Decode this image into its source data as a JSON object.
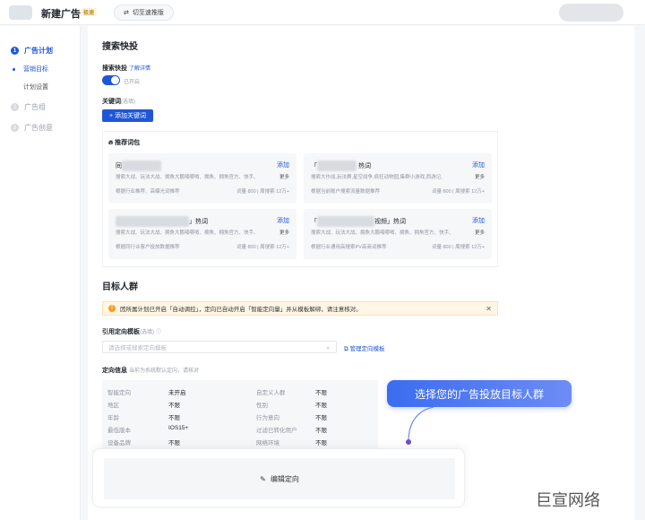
{
  "header": {
    "title": "新建广告",
    "speed_tag": "极速",
    "switch_label": "切至速推版"
  },
  "sidebar": {
    "items": [
      {
        "num": "1",
        "label": "广告计划",
        "active": true
      },
      {
        "num": "2",
        "label": "广告组",
        "active": false
      },
      {
        "num": "3",
        "label": "广告创意",
        "active": false
      }
    ],
    "sub_items": [
      {
        "label": "营销目标",
        "active": true
      },
      {
        "label": "计划设置",
        "active": false
      }
    ]
  },
  "search_express": {
    "heading": "搜索快投",
    "label": "搜索快投",
    "learn_more": "了解详情",
    "toggle_text": "已开启",
    "keyword_label": "关键词",
    "keyword_hint": "(选填)",
    "add_keyword": "+ 添加关键词",
    "rec_title": "推荐词包",
    "cards": [
      {
        "prefix": "同",
        "suffix": "",
        "add": "添加",
        "desc": "搜索大战、玩法大战、拥魚大鹏喃哪呶、拥魚、拥魚官方、快手、",
        "more": "更多",
        "foot": "根据行业推荐、高曝光词推荐",
        "stats": "词量 800 | 周搜索 12万+"
      },
      {
        "prefix": "「",
        "suffix": "热词",
        "add": "添加",
        "desc": "搜索大作战,玩法赛,星空战争,疯狂动物园,集群小游戏,西游记,",
        "more": "更多",
        "foot": "根据当前账户搜索流量数据推荐",
        "stats": "词量 800 | 周搜索 12万+"
      },
      {
        "prefix": "",
        "suffix": "」热词",
        "add": "添加",
        "desc": "搜索大战、玩法大战、拥魚大鹏喃哪呶、拥魚、拥魚官方、快手、",
        "more": "更多",
        "foot": "根据同行业客户投放数据推荐",
        "stats": "词量 800 | 周搜索 12万+"
      },
      {
        "prefix": "「",
        "suffix": "视频」热词",
        "add": "添加",
        "desc": "搜索大战、玩法大战、拥魚大鹏喃哪呶、拥魚、拥魚官方、快手、",
        "more": "更多",
        "foot": "根据行业通用高搜索PV高商词推荐",
        "stats": "词量 800 | 周搜索 12万+"
      }
    ]
  },
  "audience": {
    "heading": "目标人群",
    "alert": "因所属计划已开启「自动调控」，定向已自动开启「智能定向量」并从模板解绑，请注意核对。",
    "template_label": "引用定向模板",
    "template_hint": "(选填)",
    "template_placeholder": "请选择或搜索定向模板",
    "manage_template": "管理定向模板",
    "targeting_label": "定向信息",
    "targeting_hint": "当前为系统默认定向，请核对",
    "rows": [
      {
        "k1": "智能定向",
        "v1": "未开启",
        "k2": "自定义人群",
        "v2": "不限"
      },
      {
        "k1": "地区",
        "v1": "不限",
        "k2": "性别",
        "v2": "不限"
      },
      {
        "k1": "年龄",
        "v1": "不限",
        "k2": "行为意向",
        "v2": "不限"
      },
      {
        "k1": "最低版本",
        "v1": "IOS15+",
        "k2": "过滤已转化用户",
        "v2": "不限"
      },
      {
        "k1": "设备品牌",
        "v1": "不限",
        "k2": "网络环境",
        "v2": "不限"
      }
    ],
    "edit_label": "编辑定向"
  },
  "callout": "选择您的广告投放目标人群",
  "watermark": "巨宣网络",
  "colors": {
    "accent": "#1e56d6",
    "warning": "#ff9a1f",
    "callout": "#3b6cf0"
  }
}
